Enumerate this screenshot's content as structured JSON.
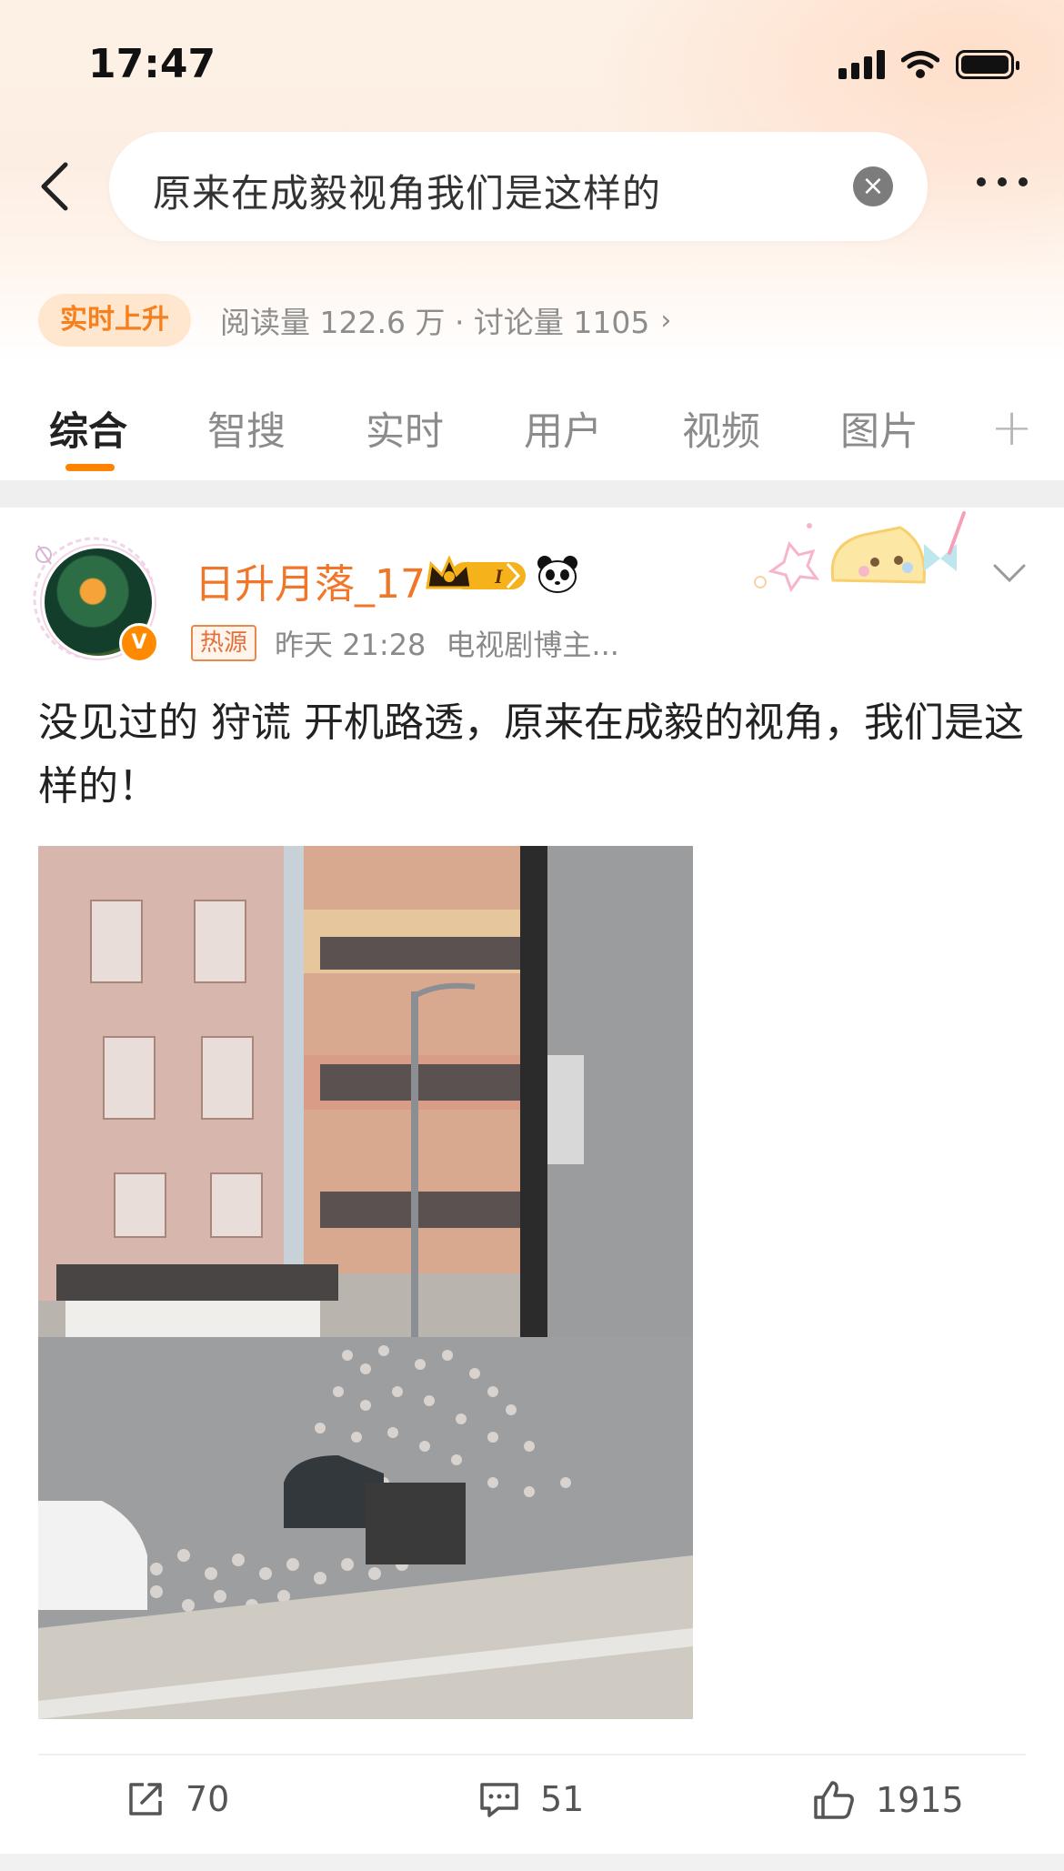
{
  "status_bar": {
    "time": "17:47"
  },
  "search": {
    "query": "原来在成毅视角我们是这样的"
  },
  "trend": {
    "badge": "实时上升",
    "stats": "阅读量 122.6 万 · 讨论量 1105"
  },
  "tabs": [
    {
      "label": "综合",
      "active": true
    },
    {
      "label": "智搜"
    },
    {
      "label": "实时"
    },
    {
      "label": "用户"
    },
    {
      "label": "视频"
    },
    {
      "label": "图片"
    }
  ],
  "post": {
    "username": "日升月落_17",
    "hot_tag": "热源",
    "time": "昨天 21:28",
    "source": "电视剧博主...",
    "text": "没见过的 狩谎 开机路透，原来在成毅的视角，我们是这样的！",
    "actions": {
      "repost": "70",
      "comment": "51",
      "like": "1915"
    }
  },
  "colors": {
    "accent": "#ff8200",
    "username": "#f0762a",
    "trend_badge_bg": "#ffe6cf"
  },
  "icons": [
    "back-arrow-icon",
    "clear-icon",
    "more-icon",
    "plus-icon",
    "verified-icon",
    "vip-crown-icon",
    "panda-icon",
    "chevron-down-icon",
    "repost-icon",
    "comment-icon",
    "like-icon"
  ]
}
